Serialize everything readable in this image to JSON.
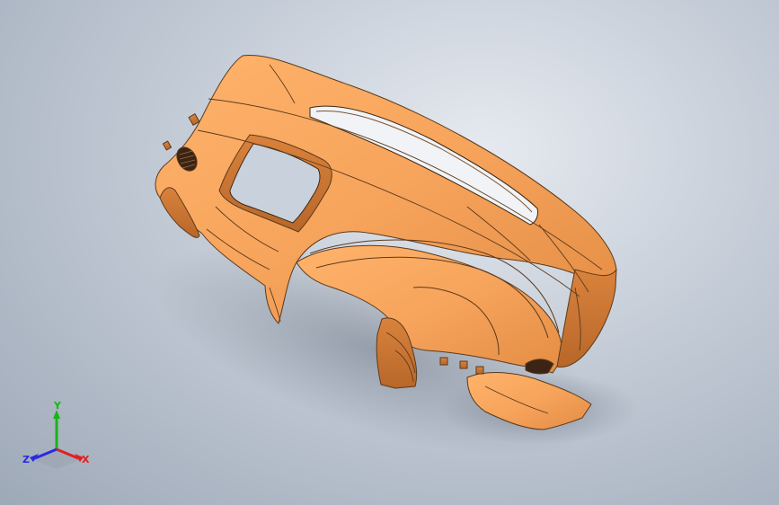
{
  "viewport": {
    "model_icon": "dashboard-3d-model",
    "background": "#b3bcc8",
    "model_color": "#f4a35e",
    "edge_color": "#5a3a1c"
  },
  "triad": {
    "x_label": "X",
    "y_label": "Y",
    "z_label": "Z",
    "x_color": "#e02020",
    "y_color": "#18b418",
    "z_color": "#2a2ae0"
  }
}
